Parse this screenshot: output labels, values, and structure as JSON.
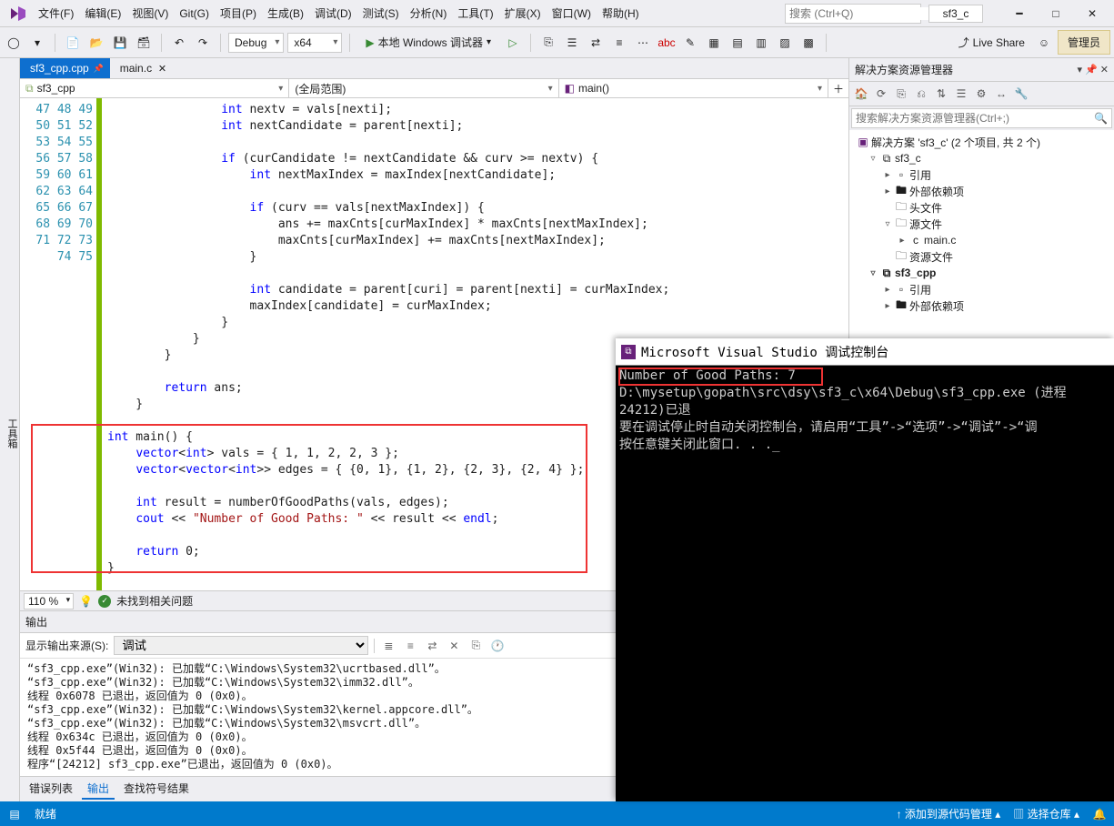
{
  "title_bar": {
    "menus": [
      "文件(F)",
      "编辑(E)",
      "视图(V)",
      "Git(G)",
      "项目(P)",
      "生成(B)",
      "调试(D)",
      "测试(S)",
      "分析(N)",
      "工具(T)",
      "扩展(X)",
      "窗口(W)",
      "帮助(H)"
    ],
    "search_placeholder": "搜索 (Ctrl+Q)",
    "solution_short": "sf3_c",
    "admin_label": "管理员"
  },
  "toolbar": {
    "config": "Debug",
    "platform": "x64",
    "debug_label": "本地 Windows 调试器",
    "live_share": "Live Share"
  },
  "left_strip": "工具箱",
  "editor": {
    "tabs": [
      {
        "label": "sf3_cpp.cpp",
        "active": true,
        "pinned": true
      },
      {
        "label": "main.c",
        "active": false,
        "pinned": false
      }
    ],
    "nav1": "sf3_cpp",
    "nav2": "(全局范围)",
    "nav3": "main()",
    "line_start": 47,
    "line_end": 75,
    "lines": [
      "                int nextv = vals[nexti];",
      "                int nextCandidate = parent[nexti];",
      "",
      "                if (curCandidate != nextCandidate && curv >= nextv) {",
      "                    int nextMaxIndex = maxIndex[nextCandidate];",
      "",
      "                    if (curv == vals[nextMaxIndex]) {",
      "                        ans += maxCnts[curMaxIndex] * maxCnts[nextMaxIndex];",
      "                        maxCnts[curMaxIndex] += maxCnts[nextMaxIndex];",
      "                    }",
      "",
      "                    int candidate = parent[curi] = parent[nexti] = curMaxIndex;",
      "                    maxIndex[candidate] = curMaxIndex;",
      "                }",
      "            }",
      "        }",
      "",
      "        return ans;",
      "    }",
      "",
      "int main() {",
      "    vector<int> vals = { 1, 1, 2, 2, 3 };",
      "    vector<vector<int>> edges = { {0, 1}, {1, 2}, {2, 3}, {2, 4} };",
      "",
      "    int result = numberOfGoodPaths(vals, edges);",
      "    cout << \"Number of Good Paths: \" << result << endl;",
      "",
      "    return 0;",
      "}"
    ],
    "zoom": "110 %",
    "issues_label": "未找到相关问题"
  },
  "output": {
    "title": "输出",
    "source_label": "显示输出来源(S):",
    "source_value": "调试",
    "body": "“sf3_cpp.exe”(Win32): 已加载“C:\\Windows\\System32\\ucrtbased.dll”。\n“sf3_cpp.exe”(Win32): 已加载“C:\\Windows\\System32\\imm32.dll”。\n线程 0x6078 已退出，返回值为 0 (0x0)。\n“sf3_cpp.exe”(Win32): 已加载“C:\\Windows\\System32\\kernel.appcore.dll”。\n“sf3_cpp.exe”(Win32): 已加载“C:\\Windows\\System32\\msvcrt.dll”。\n线程 0x634c 已退出，返回值为 0 (0x0)。\n线程 0x5f44 已退出，返回值为 0 (0x0)。\n程序“[24212] sf3_cpp.exe”已退出，返回值为 0 (0x0)。",
    "tabs": [
      "错误列表",
      "输出",
      "查找符号结果"
    ],
    "active_tab": 1
  },
  "solution": {
    "title": "解决方案资源管理器",
    "search_placeholder": "搜索解决方案资源管理器(Ctrl+;)",
    "root": "解决方案 'sf3_c' (2 个项目, 共 2 个)",
    "tree": [
      {
        "ind": 1,
        "arrow": "▿",
        "ico": "⧉",
        "label": "sf3_c",
        "bold": false
      },
      {
        "ind": 2,
        "arrow": "▸",
        "ico": "▫",
        "label": "引用"
      },
      {
        "ind": 2,
        "arrow": "▸",
        "ico": "🖿",
        "label": "外部依赖项"
      },
      {
        "ind": 2,
        "arrow": "",
        "ico": "🗀",
        "label": "头文件"
      },
      {
        "ind": 2,
        "arrow": "▿",
        "ico": "🗀",
        "label": "源文件"
      },
      {
        "ind": 3,
        "arrow": "▸",
        "ico": "c",
        "label": "main.c"
      },
      {
        "ind": 2,
        "arrow": "",
        "ico": "🗀",
        "label": "资源文件"
      },
      {
        "ind": 1,
        "arrow": "▿",
        "ico": "⧉",
        "label": "sf3_cpp",
        "bold": true
      },
      {
        "ind": 2,
        "arrow": "▸",
        "ico": "▫",
        "label": "引用"
      },
      {
        "ind": 2,
        "arrow": "▸",
        "ico": "🖿",
        "label": "外部依赖项"
      }
    ]
  },
  "console": {
    "title": "Microsoft Visual Studio 调试控制台",
    "line1": "Number of Good Paths: 7",
    "rest": "\nD:\\mysetup\\gopath\\src\\dsy\\sf3_c\\x64\\Debug\\sf3_cpp.exe (进程 24212)已退\n要在调试停止时自动关闭控制台，请启用“工具”->“选项”->“调试”->“调\n按任意键关闭此窗口. . ._"
  },
  "status": {
    "ready": "就绪",
    "add_source": "添加到源代码管理",
    "select_repo": "选择仓库"
  }
}
